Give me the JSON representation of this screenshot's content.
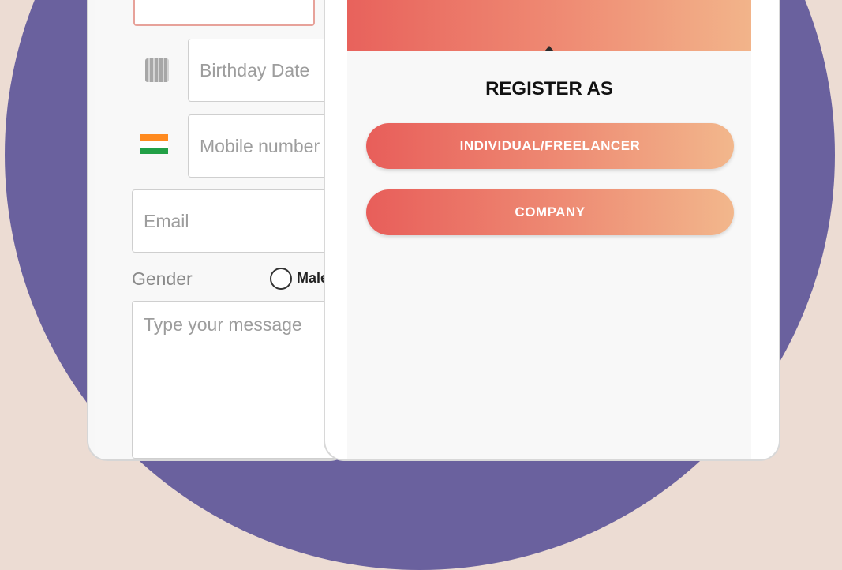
{
  "form": {
    "birthday_placeholder": "Birthday Date",
    "mobile_placeholder": "Mobile number",
    "email_placeholder": "Email",
    "gender_label": "Gender",
    "gender_option": "Male",
    "message_placeholder": "Type your message"
  },
  "register": {
    "title": "REGISTER AS",
    "options": [
      {
        "label": "INDIVIDUAL/FREELANCER"
      },
      {
        "label": "COMPANY"
      }
    ]
  },
  "icons": {
    "calendar": "calendar-icon",
    "flag": "india-flag-icon"
  },
  "colors": {
    "background_circle": "#6a619e",
    "button_gradient_start": "#e85e5a",
    "button_gradient_end": "#f2b78c"
  }
}
